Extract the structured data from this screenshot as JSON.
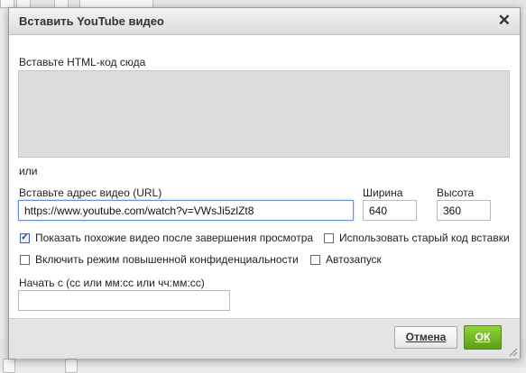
{
  "dialog": {
    "title": "Вставить YouTube видео",
    "close_icon": "close-icon",
    "html_label": "Вставьте HTML-код сюда",
    "html_value": "",
    "or_text": "или",
    "url_label": "Вставьте адрес видео (URL)",
    "url_value": "https://www.youtube.com/watch?v=VWsJi5zlZt8",
    "width_label": "Ширина",
    "width_value": "640",
    "height_label": "Высота",
    "height_value": "360",
    "options": [
      {
        "label": "Показать похожие видео после завершения просмотра",
        "checked": true
      },
      {
        "label": "Использовать старый код вставки",
        "checked": false
      },
      {
        "label": "Включить режим повышенной конфиденциальности",
        "checked": false
      },
      {
        "label": "Автозапуск",
        "checked": false
      }
    ],
    "start_label": "Начать с (сс или мм:сс или чч:мм:сс)",
    "start_value": "",
    "cancel_label": "Отмена",
    "ok_label": "ОК"
  },
  "colors": {
    "ok_button": "#6fb523",
    "url_focus_border": "#6b8fd6",
    "html_area_bg": "#dcdcdc"
  }
}
